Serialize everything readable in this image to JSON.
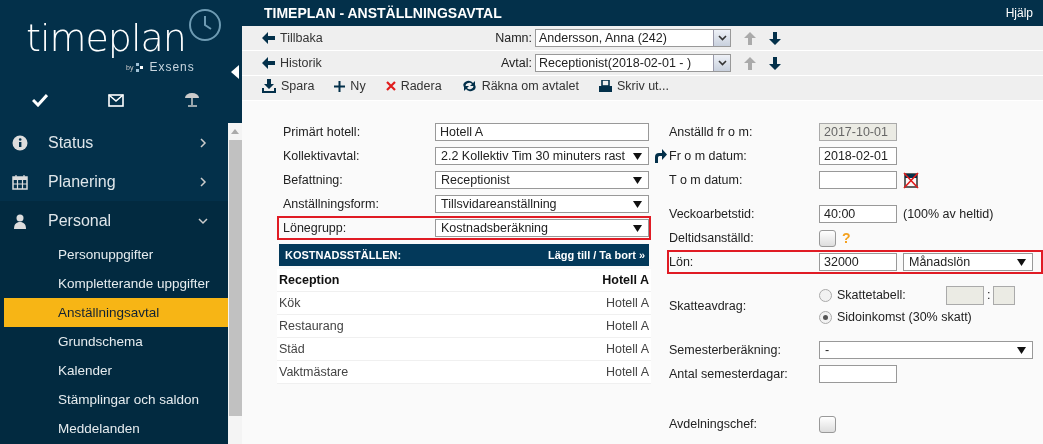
{
  "logo": {
    "name": "timeplan",
    "by": "by",
    "brand": "Exsens"
  },
  "title": "TIMEPLAN - ANSTÄLLNINGSAVTAL",
  "help": "Hjälp",
  "sidebar": {
    "items": [
      {
        "label": "Status",
        "kind": "info",
        "expanded": false
      },
      {
        "label": "Planering",
        "kind": "calendar",
        "expanded": false
      },
      {
        "label": "Personal",
        "kind": "person",
        "expanded": true,
        "children": [
          {
            "label": "Personuppgifter",
            "selected": false
          },
          {
            "label": "Kompletterande uppgifter",
            "selected": false
          },
          {
            "label": "Anställningsavtal",
            "selected": true
          },
          {
            "label": "Grundschema",
            "selected": false
          },
          {
            "label": "Kalender",
            "selected": false
          },
          {
            "label": "Stämplingar och saldon",
            "selected": false
          },
          {
            "label": "Meddelanden",
            "selected": false
          }
        ]
      }
    ]
  },
  "nav_rows": [
    {
      "link": "Tillbaka",
      "label": "Namn:",
      "value": "Andersson, Anna (242)",
      "prev_disabled": true,
      "next_disabled": false
    },
    {
      "link": "Historik",
      "label": "Avtal:",
      "value": "Receptionist(2018-02-01 - )",
      "prev_disabled": true,
      "next_disabled": false
    }
  ],
  "toolbar": [
    {
      "label": "Spara",
      "kind": "save"
    },
    {
      "label": "Ny",
      "kind": "new"
    },
    {
      "label": "Radera",
      "kind": "delete"
    },
    {
      "label": "Räkna om avtalet",
      "kind": "recalc"
    },
    {
      "label": "Skriv ut...",
      "kind": "print"
    }
  ],
  "left_form": [
    {
      "label": "Primärt hotell:",
      "kind": "field",
      "value": "Hotell A",
      "highlighted": false
    },
    {
      "label": "Kollektivavtal:",
      "kind": "select",
      "value": "2.2 Kollektiv Tim 30 minuters rast",
      "highlighted": false
    },
    {
      "label": "Befattning:",
      "kind": "select",
      "value": "Receptionist",
      "highlighted": false
    },
    {
      "label": "Anställningsform:",
      "kind": "select",
      "value": "Tillsvidareanställning",
      "highlighted": false
    },
    {
      "label": "Lönegrupp:",
      "kind": "select",
      "value": "Kostnadsberäkning",
      "highlighted": true
    }
  ],
  "cost_centers": {
    "title": "KOSTNADSSTÄLLEN:",
    "action": "Lägg till / Ta bort »",
    "rows": [
      {
        "name": "Reception",
        "hotel": "Hotell A",
        "primary": true
      },
      {
        "name": "Kök",
        "hotel": "Hotell A",
        "primary": false
      },
      {
        "name": "Restaurang",
        "hotel": "Hotell A",
        "primary": false
      },
      {
        "name": "Städ",
        "hotel": "Hotell A",
        "primary": false
      },
      {
        "name": "Vaktmästare",
        "hotel": "Hotell A",
        "primary": false
      }
    ]
  },
  "right_form": [
    {
      "label": "Anställd fr o m:",
      "kind": "field",
      "value": "2017-10-01",
      "disabled": true,
      "highlighted": false
    },
    {
      "label": "Fr o m datum:",
      "kind": "field",
      "value": "2018-02-01",
      "disabled": false,
      "highlighted": false
    },
    {
      "label": "T o m datum:",
      "kind": "date",
      "disabled": false,
      "highlighted": false
    },
    {
      "label": "Veckoarbetstid:",
      "kind": "field",
      "value": "40:00",
      "note": "(100% av heltid)",
      "disabled": false,
      "highlighted": false
    },
    {
      "label": "Deltidsanställd:",
      "kind": "checkbox",
      "checked": false,
      "help": "?",
      "highlighted": false
    },
    {
      "label": "Lön:",
      "kind": "salary",
      "value": "32000",
      "option": "Månadslön",
      "highlighted": true
    },
    {
      "label": "Skatteavdrag:",
      "kind": "radios",
      "highlighted": false,
      "separator": ":",
      "options": [
        {
          "label": "Skattetabell:",
          "selected": false
        },
        {
          "label": "Sidoinkomst (30% skatt)",
          "selected": true
        }
      ]
    },
    {
      "label": "Semesterberäkning:",
      "kind": "select",
      "value": "-",
      "highlighted": false
    },
    {
      "label": "Antal semesterdagar:",
      "kind": "field",
      "disabled": false,
      "highlighted": false
    },
    {
      "label": "Avdelningschef:",
      "kind": "checkbox",
      "checked": false,
      "highlighted": false
    }
  ]
}
